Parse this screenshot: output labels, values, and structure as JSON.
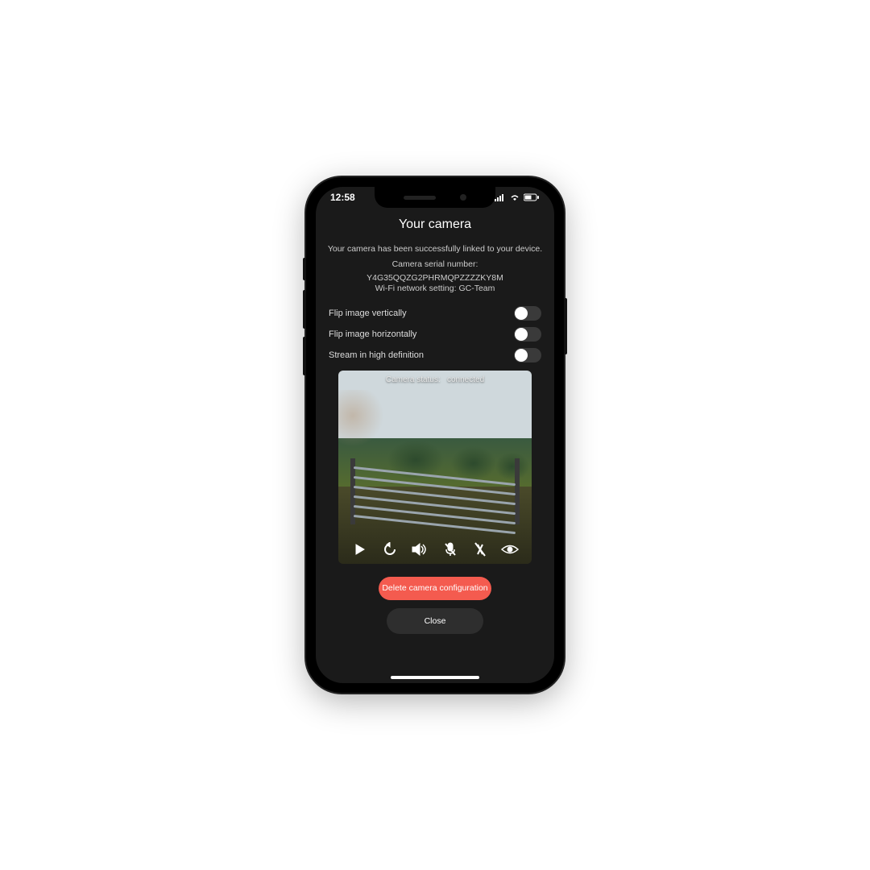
{
  "status_bar": {
    "time": "12:58"
  },
  "page": {
    "title": "Your camera",
    "linked_message": "Your camera has been successfully linked to your device.",
    "serial_label": "Camera serial number:",
    "serial_value": "Y4G35QQZG2PHRMQPZZZZKY8M",
    "wifi_label": "Wi-Fi network setting:",
    "wifi_value": "GC-Team"
  },
  "settings": {
    "flip_vertical": "Flip image vertically",
    "flip_horizontal": "Flip image horizontally",
    "stream_hd": "Stream in high definition"
  },
  "preview": {
    "status_label": "Camera status:",
    "status_value": "connected"
  },
  "buttons": {
    "delete": "Delete camera configuration",
    "close": "Close"
  },
  "colors": {
    "accent": "#f45b4f",
    "bg": "#1a1a1a"
  }
}
